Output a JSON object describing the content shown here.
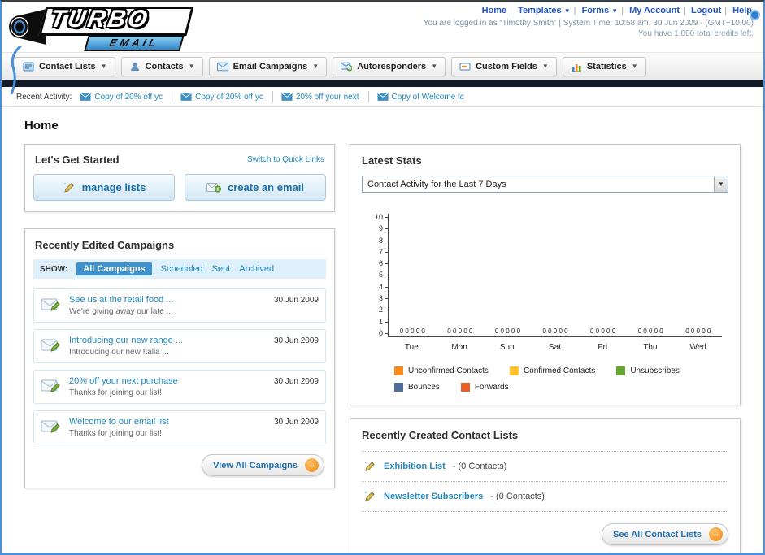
{
  "icons": {
    "pipe": "|",
    "dropdown_arrow": "▼",
    "arrow_right": "→"
  },
  "header": {
    "logo_primary": "TURBO",
    "logo_secondary": "EMAIL",
    "links": [
      "Home",
      "Templates",
      "Forms",
      "My Account",
      "Logout",
      "Help"
    ],
    "login_info": "You are logged in as “Timothy Smith” | System Time: 10:58 am, 30 Jun 2009 - (GMT+10:00)",
    "credits_info": "You have 1,000 total credits left."
  },
  "nav": {
    "tabs": [
      {
        "label": "Contact Lists"
      },
      {
        "label": "Contacts"
      },
      {
        "label": "Email Campaigns"
      },
      {
        "label": "Autoresponders"
      },
      {
        "label": "Custom Fields"
      },
      {
        "label": "Statistics"
      }
    ]
  },
  "recent_activity": {
    "label": "Recent Activity:",
    "items": [
      "Copy of 20% off yc",
      "Copy of 20% off yc",
      "20% off your next",
      "Copy of Welcome tc"
    ]
  },
  "page_title": "Home",
  "get_started": {
    "title": "Let's Get Started",
    "switch_link": "Switch to Quick Links",
    "manage_lists_label": "manage lists",
    "create_email_label": "create an email"
  },
  "campaigns": {
    "title": "Recently Edited Campaigns",
    "show_label": "SHOW:",
    "filters": [
      "All Campaigns",
      "Scheduled",
      "Sent",
      "Archived"
    ],
    "active_filter": "All Campaigns",
    "items": [
      {
        "title": "See us at the retail food ...",
        "subtitle": "We're giving away our late ...",
        "date": "30 Jun 2009"
      },
      {
        "title": "Introducing our new range ...",
        "subtitle": "Introducing our new Italia ...",
        "date": "30 Jun 2009"
      },
      {
        "title": "20% off your next purchase",
        "subtitle": "Thanks for joining our list!",
        "date": "30 Jun 2009"
      },
      {
        "title": "Welcome to our email list",
        "subtitle": "Thanks for joining our list!",
        "date": "30 Jun 2009"
      }
    ],
    "view_all_label": "View All Campaigns"
  },
  "stats": {
    "title": "Latest Stats",
    "dropdown_value": "Contact Activity for the Last 7 Days"
  },
  "chart_data": {
    "type": "bar",
    "title": "Contact Activity for the Last 7 Days",
    "categories": [
      "Tue",
      "Mon",
      "Sun",
      "Sat",
      "Fri",
      "Thu",
      "Wed"
    ],
    "series": [
      {
        "name": "Unconfirmed Contacts",
        "color": "#f68b1f",
        "values": [
          0,
          0,
          0,
          0,
          0,
          0,
          0
        ]
      },
      {
        "name": "Confirmed Contacts",
        "color": "#fdc22d",
        "values": [
          0,
          0,
          0,
          0,
          0,
          0,
          0
        ]
      },
      {
        "name": "Unsubscribes",
        "color": "#62a831",
        "values": [
          0,
          0,
          0,
          0,
          0,
          0,
          0
        ]
      },
      {
        "name": "Bounces",
        "color": "#4f6e9c",
        "values": [
          0,
          0,
          0,
          0,
          0,
          0,
          0
        ]
      },
      {
        "name": "Forwards",
        "color": "#e65f2b",
        "values": [
          0,
          0,
          0,
          0,
          0,
          0,
          0
        ]
      }
    ],
    "ylim": [
      0,
      10
    ],
    "yticks_top_to_bottom": [
      "10",
      "9",
      "8",
      "7",
      "6",
      "5",
      "4",
      "3",
      "2",
      "1",
      "0"
    ],
    "point_value_label": "0 0 0 0 0",
    "grid": false,
    "legend_position": "bottom"
  },
  "contact_lists": {
    "title": "Recently Created Contact Lists",
    "items": [
      {
        "name": "Exhibition List",
        "detail": "- (0 Contacts)"
      },
      {
        "name": "Newsletter Subscribers",
        "detail": "- (0 Contacts)"
      }
    ],
    "see_all_label": "See All Contact Lists"
  }
}
